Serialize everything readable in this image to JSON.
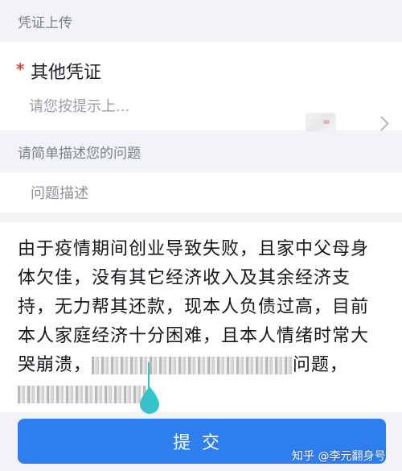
{
  "upload_section": {
    "header": "凭证上传",
    "required_mark": "*",
    "field_label": "其他凭证",
    "field_hint": "请您按提示上..."
  },
  "description_section": {
    "header": "请简单描述您的问题",
    "field_label": "问题描述",
    "lines": [
      "由于疫情期间创业导致失败，且家中父母身",
      "体欠佳，没有其它经济收入及其余经济支",
      "持，无力帮其还款，现本人负债过高，目前",
      "本人家庭经济十分困难，且本人情绪时常大",
      "哭崩溃，",
      "问题，"
    ]
  },
  "submit": {
    "label": "提交"
  },
  "watermark": "知乎 @李元翻身号",
  "colors": {
    "accent": "#2f7ef0",
    "required": "#e33b3b",
    "background": "#f2f3f6"
  },
  "icons": {
    "chevron": "chevron-right-icon",
    "thumbnail": "voucher-thumbnail",
    "handle": "text-selection-handle-icon"
  }
}
